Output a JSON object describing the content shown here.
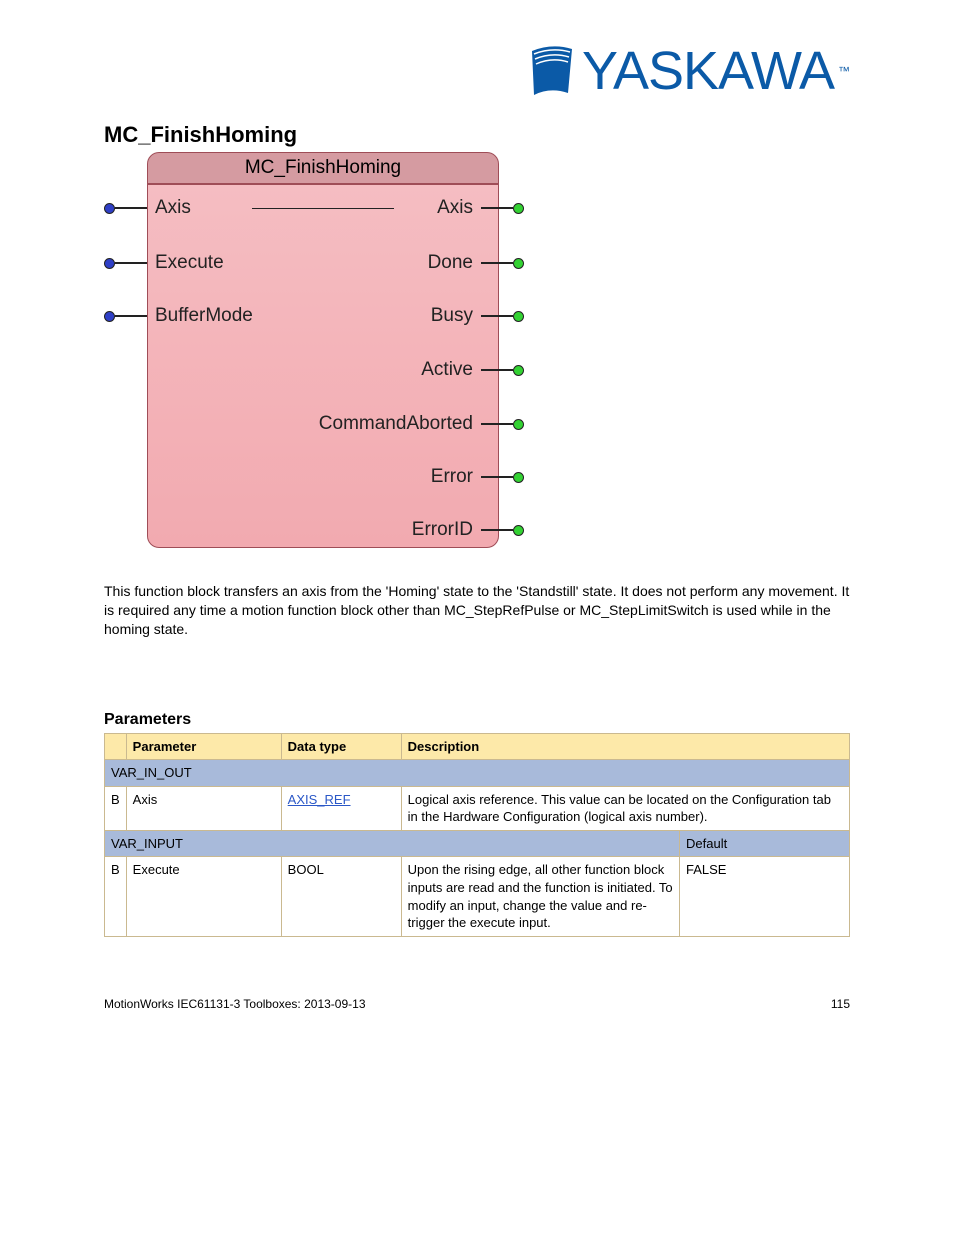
{
  "logo": {
    "text": "YASKAWA"
  },
  "title": "MC_FinishHoming",
  "fb": {
    "title": "MC_FinishHoming",
    "inputs": [
      "Axis",
      "Execute",
      "BufferMode"
    ],
    "outputs": [
      "Axis",
      "Done",
      "Busy",
      "Active",
      "CommandAborted",
      "Error",
      "ErrorID"
    ]
  },
  "desc": "This function block transfers an axis from the 'Homing' state to the 'Standstill' state. It does not perform any movement. It is required any time a motion function block other than MC_StepRefPulse or MC_StepLimitSwitch is used while in the homing state.",
  "params_heading": "Parameters",
  "table": {
    "headers": {
      "param": "Parameter",
      "type": "Data type",
      "desc": "Description",
      "default": "Default"
    },
    "sections": {
      "var_in_out": {
        "label": "VAR_IN_OUT",
        "note": ""
      },
      "var_input": {
        "label": "VAR_INPUT",
        "default": "Default"
      }
    },
    "rows": [
      {
        "b": "B",
        "param": "Axis",
        "type_link": "AXIS_REF",
        "type_text": "AXIS_REF",
        "desc": "Logical axis reference. This value can be located on the Configuration tab in the Hardware Configuration (logical axis number)."
      },
      {
        "b": "B",
        "param": "Execute",
        "type_text": "BOOL",
        "desc": "Upon the rising edge, all other function block inputs are read and the function is initiated. To modify an input, change the value and re-trigger the execute input.",
        "default": "FALSE"
      }
    ]
  },
  "footer": {
    "left": "MotionWorks IEC61131-3 Toolboxes: 2013-09-13",
    "right": "115"
  }
}
